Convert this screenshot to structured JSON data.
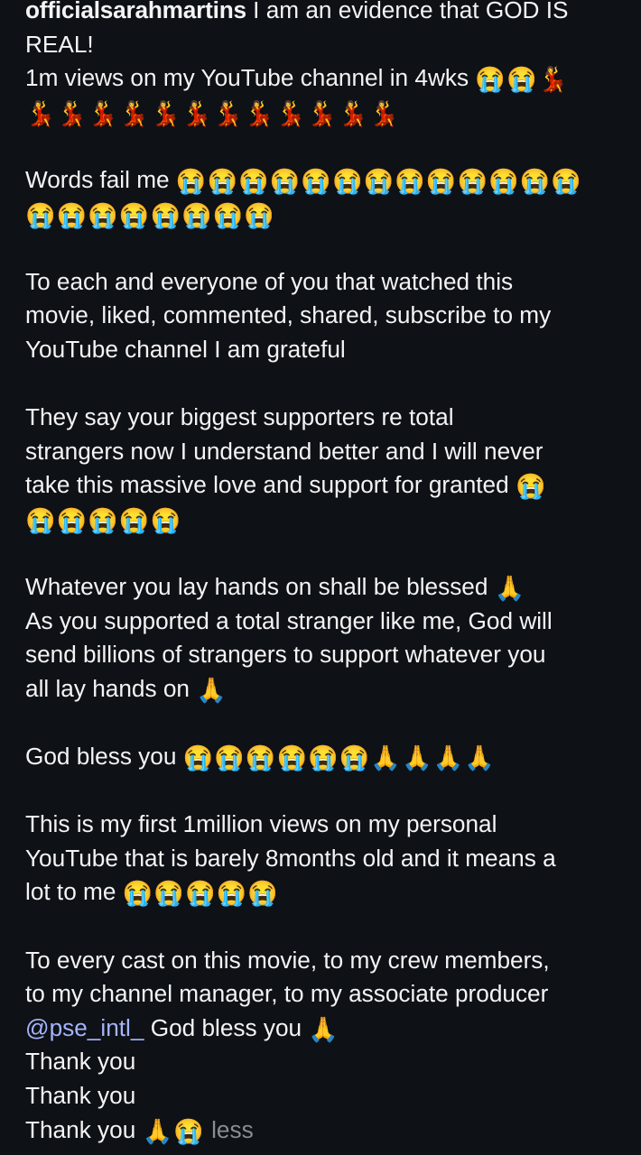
{
  "post": {
    "username": "officialsarahmartins",
    "line1": " I am an evidence that GOD IS",
    "line2": "REAL!",
    "line3": "1m views on my YouTube channel in 4wks ",
    "line3_emoji": "😭😭💃",
    "line4_emoji": "💃💃💃💃💃💃💃💃💃💃💃💃",
    "words_fail": "Words fail me ",
    "words_fail_emoji1": "😭😭😭😭😭😭😭😭😭😭😭😭😭",
    "words_fail_emoji2": "😭😭😭😭😭😭😭😭",
    "p3_l1": "To each and everyone of you that watched this",
    "p3_l2": "movie, liked, commented, shared, subscribe to my",
    "p3_l3": "YouTube channel I am grateful",
    "p4_l1": "They say your biggest supporters re total",
    "p4_l2": "strangers now I understand better and I will never",
    "p4_l3": "take this massive love and support for granted ",
    "p4_l3_emoji": "😭",
    "p4_l4_emoji": "😭😭😭😭😭",
    "p5_l1": "Whatever you lay hands on shall be blessed ",
    "p5_l1_emoji": "🙏",
    "p5_l2": "As you supported a total stranger like me, God will",
    "p5_l3": "send billions of strangers to support whatever you",
    "p5_l4": "all lay hands on ",
    "p5_l4_emoji": "🙏",
    "p6_l1": "God bless you ",
    "p6_l1_emoji": "😭😭😭😭😭😭🙏🙏🙏🙏",
    "p7_l1": "This is my first 1million views on my personal",
    "p7_l2": "YouTube that is barely 8months  old and it means a",
    "p7_l3": "lot to me ",
    "p7_l3_emoji": "😭😭😭😭😭",
    "p8_l1": "To every cast on this movie, to my crew members,",
    "p8_l2": "to my channel manager, to my associate producer",
    "p8_mention": "@pse_intl_",
    "p8_l3": "  God bless you ",
    "p8_l3_emoji": "🙏",
    "thank1": "Thank you",
    "thank2": "Thank you",
    "thank3": "Thank you ",
    "thank3_emoji": "🙏😭",
    "less_label": " less"
  }
}
